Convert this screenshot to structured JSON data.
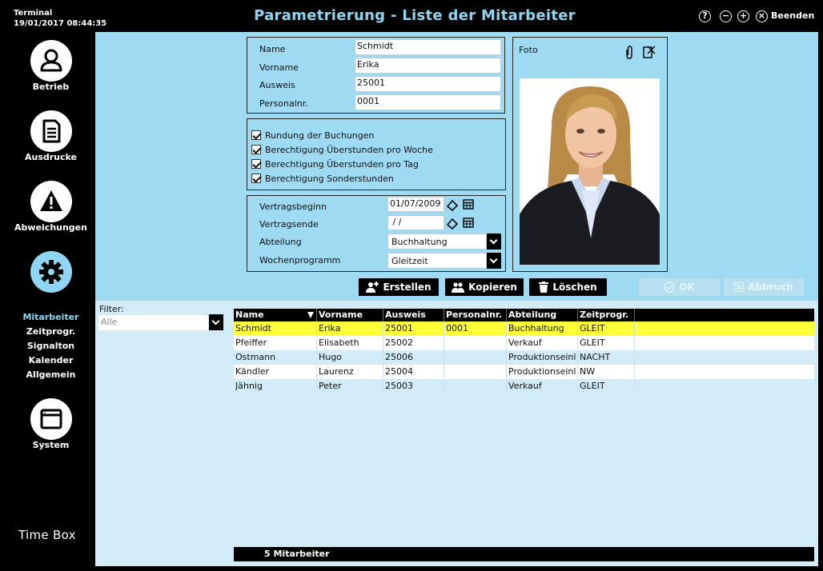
{
  "titlebar": {
    "terminal": "Terminal",
    "datetime": "19/01/2017 08:44:35",
    "title": "Parametrierung - Liste der Mitarbeiter",
    "help": "?",
    "minus": "−",
    "plus": "+",
    "close": "×",
    "beenden": "Beenden"
  },
  "sidebar": {
    "items": [
      {
        "label": "Betrieb",
        "icon": "person-icon"
      },
      {
        "label": "Ausdrucke",
        "icon": "document-icon"
      },
      {
        "label": "Abweichungen",
        "icon": "warning-icon"
      },
      {
        "label": "",
        "icon": "gear-icon"
      },
      {
        "label": "System",
        "icon": "window-icon"
      }
    ],
    "subnav": [
      "Mitarbeiter",
      "Zeitprogr.",
      "Signalton",
      "Kalender",
      "Allgemein"
    ],
    "brand": "Time Box",
    "active_color": "#8fd6f2"
  },
  "form": {
    "name_label": "Name",
    "name_value": "Schmidt",
    "vorname_label": "Vorname",
    "vorname_value": "Erika",
    "ausweis_label": "Ausweis",
    "ausweis_value": "25001",
    "personalnr_label": "Personalnr.",
    "personalnr_value": "0001",
    "checks": [
      "Rundung der Buchungen",
      "Berechtigung Überstunden pro Woche",
      "Berechtigung Überstunden pro Tag",
      "Berechtigung Sonderstunden"
    ],
    "vertragsbeginn_label": "Vertragsbeginn",
    "vertragsbeginn_value": "01/07/2009",
    "vertragsende_label": "Vertragsende",
    "vertragsende_value": " / /",
    "abteilung_label": "Abteilung",
    "abteilung_value": "Buchhaltung",
    "wochenprogramm_label": "Wochenprogramm",
    "wochenprogramm_value": "Gleitzeit",
    "foto_label": "Foto"
  },
  "actions": {
    "erstellen": "Erstellen",
    "kopieren": "Kopieren",
    "loeschen": "Löschen",
    "ok": "OK",
    "abbruch": "Abbruch"
  },
  "filter": {
    "label": "Filter:",
    "value": "Alle"
  },
  "grid": {
    "headers": [
      "Name",
      "Vorname",
      "Ausweis",
      "Personalnr.",
      "Abteilung",
      "Zeitprogr."
    ],
    "rows": [
      [
        "Schmidt",
        "Erika",
        "25001",
        "0001",
        "Buchhaltung",
        "GLEIT"
      ],
      [
        "Pfeiffer",
        "Elisabeth",
        "25002",
        "",
        "Verkauf",
        "GLEIT"
      ],
      [
        "Ostmann",
        "Hugo",
        "25006",
        "",
        "Produktionseinl",
        "NACHT"
      ],
      [
        "Kändler",
        "Laurenz",
        "25004",
        "",
        "Produktionseinl",
        "NW"
      ],
      [
        "Jähnig",
        "Peter",
        "25003",
        "",
        "Verkauf",
        "GLEIT"
      ]
    ],
    "selected_color": "#ffff3a",
    "footer": "5 Mitarbeiter"
  }
}
